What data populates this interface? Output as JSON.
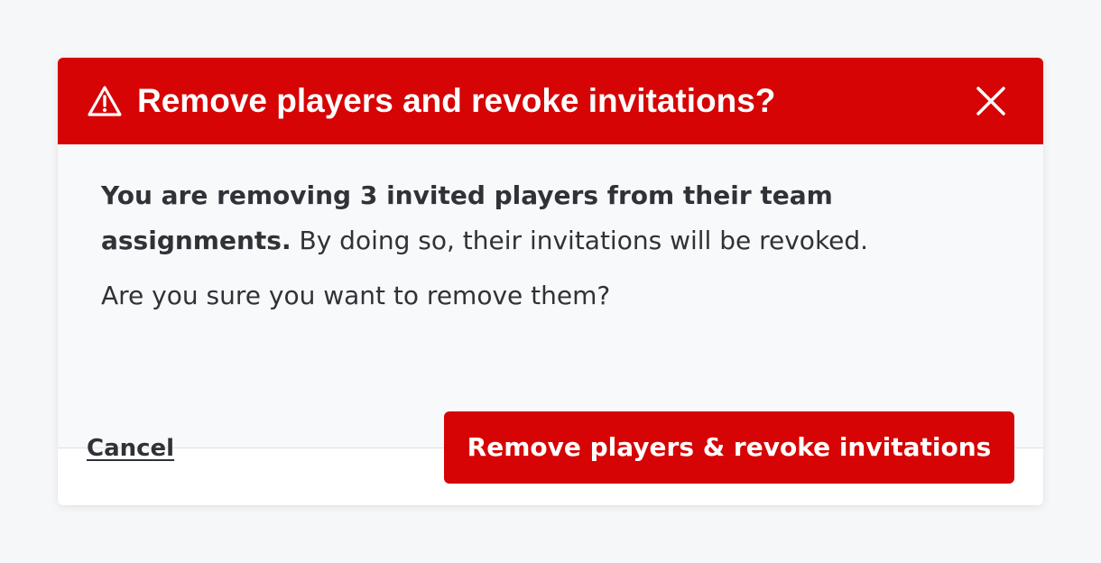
{
  "dialog": {
    "title": "Remove players and revoke invitations?",
    "header_icon": "warning-icon",
    "close_icon": "close-icon",
    "message_bold": "You are removing 3 invited players from their team assignments.",
    "message_rest": " By doing so, their invitations will be revoked.",
    "question": "Are you sure you want to remove them?",
    "cancel_label": "Cancel",
    "confirm_label": "Remove players & revoke invitations"
  },
  "colors": {
    "accent": "#d60404",
    "text": "#2f3237",
    "page_bg": "#f6f7f9",
    "body_bg": "#f8f9fb"
  }
}
